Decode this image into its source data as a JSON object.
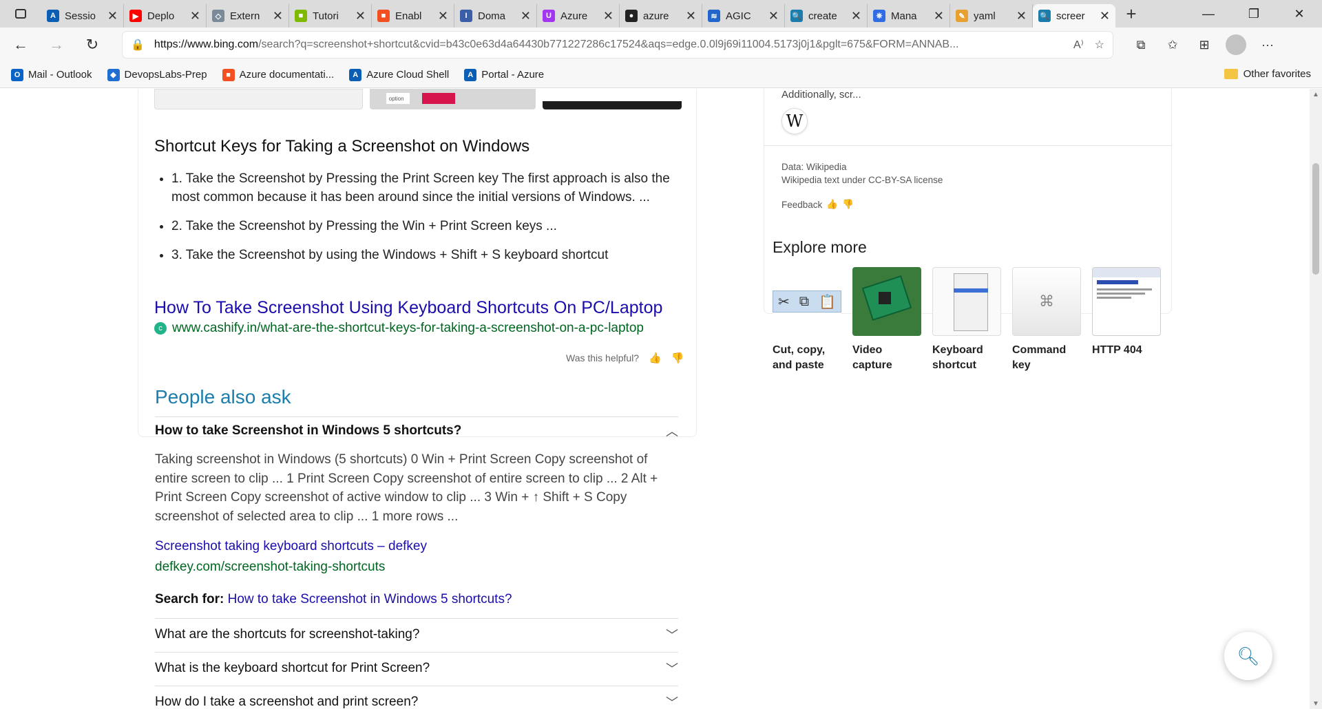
{
  "tabs": [
    {
      "title": "Sessio",
      "icon": "azure-icon",
      "color": "#0a5fb4",
      "glyph": "A"
    },
    {
      "title": "Deplo",
      "icon": "youtube-icon",
      "color": "#ff0000",
      "glyph": "▶"
    },
    {
      "title": "Extern",
      "icon": "portal-icon",
      "color": "#7a8a99",
      "glyph": "◇"
    },
    {
      "title": "Tutori",
      "icon": "microsoft-icon",
      "color": "#7fba00",
      "glyph": "■"
    },
    {
      "title": "Enabl",
      "icon": "microsoft-icon",
      "color": "#f25022",
      "glyph": "■"
    },
    {
      "title": "Doma",
      "icon": "document-icon",
      "color": "#3b5ea8",
      "glyph": "I"
    },
    {
      "title": "Azure",
      "icon": "udemy-icon",
      "color": "#a435f0",
      "glyph": "U"
    },
    {
      "title": "azure",
      "icon": "github-icon",
      "color": "#222222",
      "glyph": "●"
    },
    {
      "title": "AGIC",
      "icon": "azure-icon",
      "color": "#2266cc",
      "glyph": "≋"
    },
    {
      "title": "create",
      "icon": "bing-search-icon",
      "color": "#1a7dac",
      "glyph": "🔍"
    },
    {
      "title": "Mana",
      "icon": "kubernetes-icon",
      "color": "#326ce5",
      "glyph": "⎈"
    },
    {
      "title": "yaml",
      "icon": "pen-icon",
      "color": "#e8a030",
      "glyph": "✎"
    },
    {
      "title": "screer",
      "icon": "bing-search-icon",
      "color": "#1a7dac",
      "glyph": "🔍"
    }
  ],
  "address": {
    "host": "https://www.bing.com",
    "rest": "/search?q=screenshot+shortcut&cvid=b43c0e63d4a64430b771227286c17524&aqs=edge.0.0l9j69i11004.5173j0j1&pglt=675&FORM=ANNAB..."
  },
  "favorites": [
    {
      "label": "Mail - Outlook",
      "color": "#0a64c8",
      "glyph": "O"
    },
    {
      "label": "DevopsLabs-Prep",
      "color": "#1e6fd0",
      "glyph": "◆"
    },
    {
      "label": "Azure documentati...",
      "color": "#f25022",
      "glyph": "■"
    },
    {
      "label": "Azure Cloud Shell",
      "color": "#0a5fb4",
      "glyph": "A"
    },
    {
      "label": "Portal - Azure",
      "color": "#0a5fb4",
      "glyph": "A"
    }
  ],
  "other_favorites": "Other favorites",
  "answer": {
    "title": "Shortcut Keys for Taking a Screenshot on Windows",
    "items": [
      "1. Take the Screenshot by Pressing the Print Screen key The first approach is also the most common because it has been around since the initial versions of Windows. ...",
      "2. Take the Screenshot by Pressing the Win + Print Screen keys ...",
      "3. Take the Screenshot by using the Windows + Shift + S keyboard shortcut"
    ],
    "link": "How To Take Screenshot Using Keyboard Shortcuts On PC/Laptop",
    "cite": "www.cashify.in/what-are-the-shortcut-keys-for-taking-a-screenshot-on-a-pc-laptop",
    "strip_option": "option",
    "helpful": "Was this helpful?"
  },
  "paa": {
    "title": "People also ask",
    "open_question": "How to take Screenshot in Windows 5 shortcuts?",
    "open_answer": "Taking screenshot in Windows (5 shortcuts) 0 Win + Print Screen Copy screenshot of entire screen to clip ... 1 Print Screen Copy screenshot of entire screen to clip ... 2 Alt + Print Screen Copy screenshot of active window to clip ... 3 Win + ↑ Shift + S Copy screenshot of selected area to clip ... 1 more rows ...",
    "link": "Screenshot taking keyboard shortcuts – defkey",
    "cite": "defkey.com/screenshot-taking-shortcuts",
    "search_for_label": "Search for:",
    "search_for_link": "How to take Screenshot in Windows 5 shortcuts?",
    "questions": [
      "What are the shortcuts for screenshot-taking?",
      "What is the keyboard shortcut for Print Screen?",
      "How do I take a screenshot and print screen?"
    ]
  },
  "wiki": {
    "truncated": "Additionally, scr...",
    "data_source": "Data: Wikipedia",
    "license": "Wikipedia text under CC-BY-SA license",
    "feedback": "Feedback"
  },
  "explore": {
    "title": "Explore more",
    "items": [
      {
        "label1": "Cut, copy,",
        "label2": "and paste"
      },
      {
        "label1": "Video",
        "label2": "capture"
      },
      {
        "label1": "Keyboard",
        "label2": "shortcut"
      },
      {
        "label1": "Command",
        "label2": "key"
      },
      {
        "label1": "HTTP 404",
        "label2": ""
      }
    ]
  }
}
